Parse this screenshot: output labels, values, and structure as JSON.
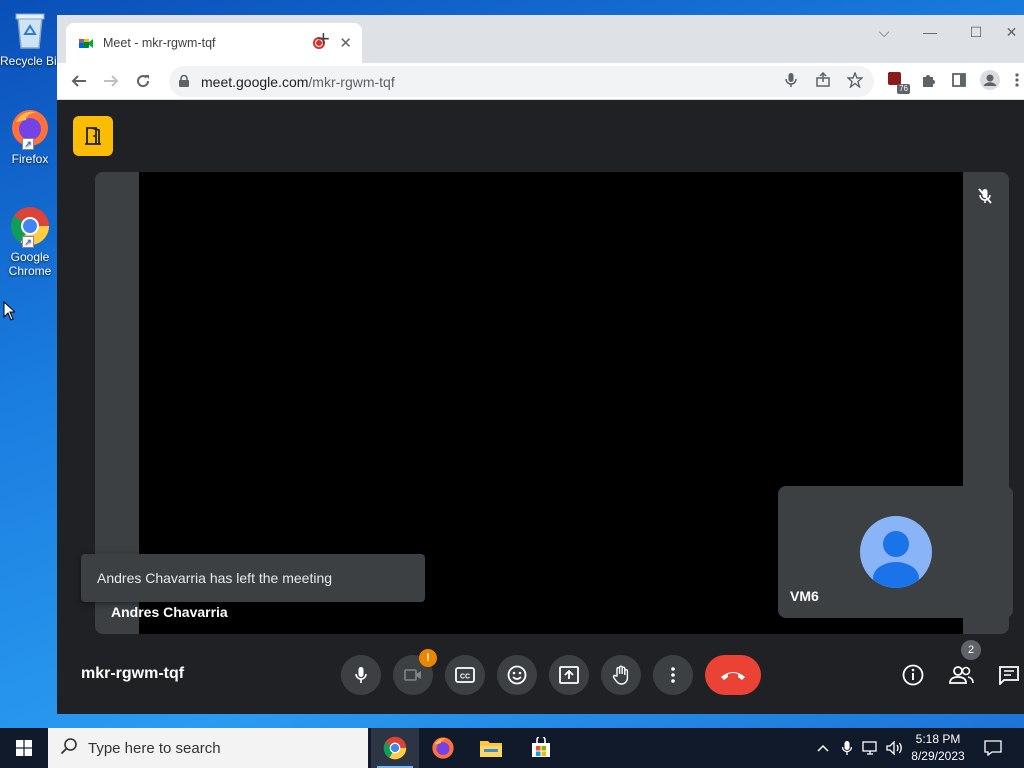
{
  "desktop": {
    "icons": [
      {
        "label": "Recycle Bin",
        "icon": "recycle-bin-icon"
      },
      {
        "label": "Firefox",
        "icon": "firefox-icon"
      },
      {
        "label": "Google Chrome",
        "icon": "chrome-icon"
      }
    ]
  },
  "browser": {
    "tab": {
      "title": "Meet - mkr-rgwm-tqf",
      "close": "✕",
      "recording": true
    },
    "new_tab": "+",
    "window_controls": {
      "dropdown": "⌵",
      "minimize": "—",
      "maximize": "☐",
      "close": "✕"
    },
    "address": {
      "host": "meet.google.com",
      "path": "/mkr-rgwm-tqf"
    },
    "extension_badge": "76"
  },
  "meet": {
    "main_tile": {
      "participant": "Andres Chavarria",
      "muted": true
    },
    "toast": "Andres Chavarria has left the meeting",
    "self_tile": {
      "name": "VM6"
    },
    "meeting_code": "mkr-rgwm-tqf",
    "camera_warning": "!",
    "participant_count": "2",
    "colors": {
      "accent_yellow": "#fbbc04",
      "end_call_red": "#ea4335",
      "background": "#202124",
      "tile": "#3c4043",
      "warning": "#ea8600"
    }
  },
  "taskbar": {
    "search_placeholder": "Type here to search",
    "time": "5:18 PM",
    "date": "8/29/2023"
  }
}
